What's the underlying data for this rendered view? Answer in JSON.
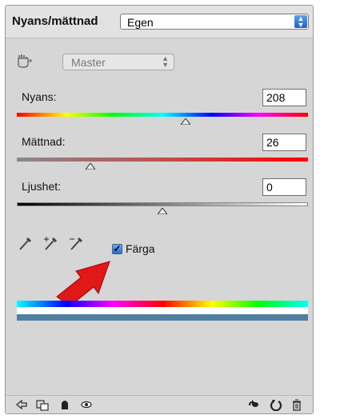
{
  "header": {
    "title": "Nyans/mättnad",
    "preset_value": "Egen"
  },
  "channel": {
    "value": "Master"
  },
  "sliders": [
    {
      "label": "Nyans:",
      "value": "208"
    },
    {
      "label": "Mättnad:",
      "value": "26"
    },
    {
      "label": "Ljushet:",
      "value": "0"
    }
  ],
  "colorize": {
    "label": "Färga",
    "checked": true
  },
  "colors": {
    "result_bar": "#4f7fa1",
    "arrow": "#e01818",
    "checkbox": "#2a6fd0"
  },
  "icons": {
    "hand": "targeted-adjustment-hand-icon",
    "eyedroppers": [
      "eyedropper-icon",
      "eyedropper-add-icon",
      "eyedropper-subtract-icon"
    ],
    "footer": [
      "back-icon",
      "clip-to-layer-icon",
      "visibility-eye-icon",
      "view-previous-icon",
      "reset-icon",
      "trash-icon"
    ]
  }
}
